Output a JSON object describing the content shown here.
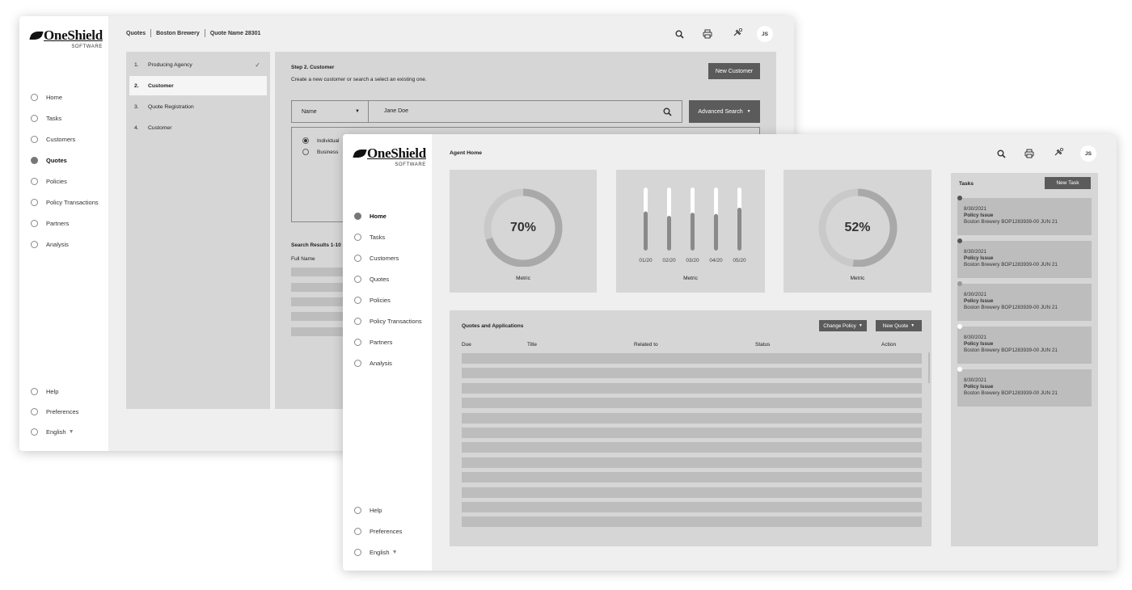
{
  "logo": {
    "main": "OneShield",
    "sub": "SOFTWARE"
  },
  "back": {
    "breadcrumb": [
      "Quotes",
      "Boston Brewery",
      "Quote Name 28301"
    ],
    "nav": [
      "Home",
      "Tasks",
      "Customers",
      "Quotes",
      "Policies",
      "Policy Transactions",
      "Partners",
      "Analysis"
    ],
    "nav_active": 3,
    "nav_bottom": [
      "Help",
      "Preferences",
      "English"
    ],
    "steps": [
      {
        "num": "1.",
        "label": "Producing Agency",
        "check": "✓"
      },
      {
        "num": "2.",
        "label": "Customer",
        "check": ""
      },
      {
        "num": "3.",
        "label": "Quote Registration",
        "check": ""
      },
      {
        "num": "4.",
        "label": "Customer",
        "check": ""
      }
    ],
    "step_title": "Step 2. Customer",
    "step_desc": "Create a new customer or search a select an existing one.",
    "new_customer": "New Customer",
    "search_field": "Name",
    "search_value": "Jane Doe",
    "advanced_search": "Advanced Search",
    "radio_options": [
      "Individual",
      "Business"
    ],
    "results_title": "Search Results 1-10",
    "results_col": "Full Name",
    "avatar": "JS"
  },
  "front": {
    "title": "Agent Home",
    "nav": [
      "Home",
      "Tasks",
      "Customers",
      "Quotes",
      "Policies",
      "Policy Transactions",
      "Partners",
      "Analysis"
    ],
    "nav_active": 0,
    "nav_bottom": [
      "Help",
      "Preferences",
      "English"
    ],
    "avatar": "JS",
    "metric1": {
      "value": "70%",
      "label": "Metric",
      "fraction": 0.7
    },
    "metric2": {
      "label": "Metric",
      "bars": [
        {
          "cat": "01/20",
          "level": 0.62
        },
        {
          "cat": "02/20",
          "level": 0.55
        },
        {
          "cat": "03/20",
          "level": 0.6
        },
        {
          "cat": "04/20",
          "level": 0.58
        },
        {
          "cat": "05/20",
          "level": 0.68
        }
      ]
    },
    "metric3": {
      "value": "52%",
      "label": "Metric",
      "fraction": 0.52
    },
    "quotes_title": "Quotes and Applications",
    "change_policy": "Change Policy",
    "new_quote": "New Quote",
    "columns": [
      "Due",
      "Title",
      "Related to",
      "Status",
      "Action"
    ],
    "tasks_title": "Tasks",
    "new_task": "New Task",
    "tasks": [
      {
        "date": "8/30/2021",
        "type": "Policy Issue",
        "desc": "Boston Brewery BOP1283939-00 JUN 21",
        "dot": "#555555"
      },
      {
        "date": "8/30/2021",
        "type": "Policy Issue",
        "desc": "Boston Brewery BOP1283939-00 JUN 21",
        "dot": "#555555"
      },
      {
        "date": "8/30/2021",
        "type": "Policy Issue",
        "desc": "Boston Brewery BOP1283939-00 JUN 21",
        "dot": "#999999"
      },
      {
        "date": "8/30/2021",
        "type": "Policy Issue",
        "desc": "Boston Brewery BOP1283939-00 JUN 21",
        "dot": "#ffffff"
      },
      {
        "date": "8/30/2021",
        "type": "Policy Issue",
        "desc": "Boston Brewery BOP1283939-00 JUN 21",
        "dot": "#ffffff"
      }
    ]
  }
}
